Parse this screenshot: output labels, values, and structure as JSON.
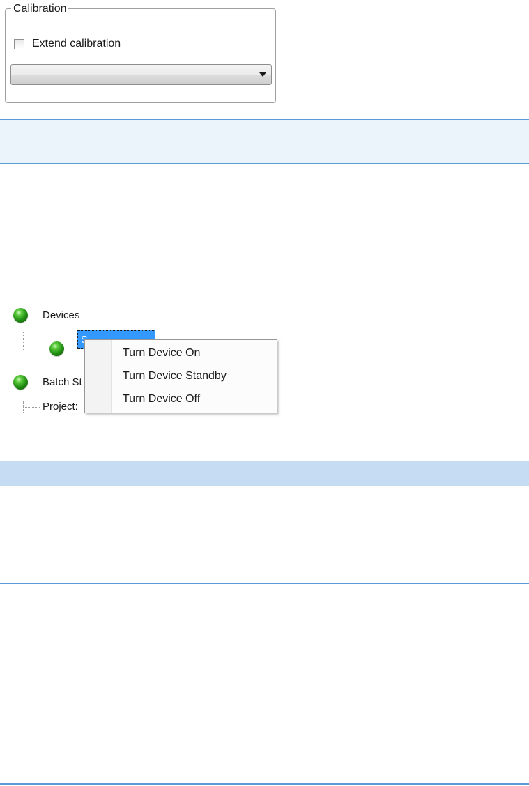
{
  "calibration": {
    "legend": "Calibration",
    "extend_label": "Extend calibration",
    "extend_checked": false,
    "dropdown_value": ""
  },
  "tree": {
    "devices_label": "Devices",
    "selected_device_label": "S",
    "batch_label": "Batch St",
    "project_label": "Project:",
    "status_color": "#2e9e1c"
  },
  "context_menu": {
    "items": [
      "Turn Device On",
      "Turn Device Standby",
      "Turn Device Off"
    ]
  },
  "colors": {
    "accent_line": "#5b9bd5",
    "band_light": "#ebf3fb",
    "band_mid": "#c5dcf2",
    "selection": "#3399ff"
  }
}
